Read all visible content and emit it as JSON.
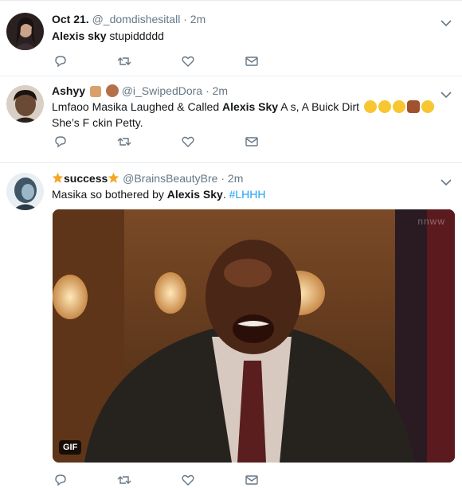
{
  "colors": {
    "link": "#1da1f2",
    "muted": "#657786",
    "divider": "#e6ecf0",
    "text": "#14171a"
  },
  "tweets": [
    {
      "name": "Oct 21.",
      "handle": "@_domdishesitall",
      "dot": "·",
      "time": "2m",
      "text_bold": "Alexis sky",
      "text_rest": " stupiddddd"
    },
    {
      "name": "Ashyy",
      "handle": "@i_SwipedDora",
      "dot": "·",
      "time": "2m",
      "text_a": "Lmfaoo Masika Laughed & Called ",
      "text_bold": "Alexis Sky",
      "text_b": " A  s, A Buick Dirt",
      "text_line2": "She’s F  ckin Petty.",
      "emojis": [
        "loudly-crying-face-emoji",
        "loudly-crying-face-emoji",
        "loudly-crying-face-emoji",
        "woman-facepalming-emoji",
        "face-with-tears-of-joy-emoji"
      ]
    },
    {
      "name": "success",
      "handle": "@BrainsBeautyBre",
      "dot": "·",
      "time": "2m",
      "text_a": "Masika so bothered by ",
      "text_bold": "Alexis Sky",
      "text_b": ". ",
      "hashtag": "#LHHH",
      "media": {
        "badge": "GIF",
        "watermark": "nnww"
      }
    }
  ],
  "icons": [
    "reply-icon",
    "retweet-icon",
    "like-icon",
    "direct-message-icon",
    "chevron-down-icon",
    "star-icon"
  ]
}
